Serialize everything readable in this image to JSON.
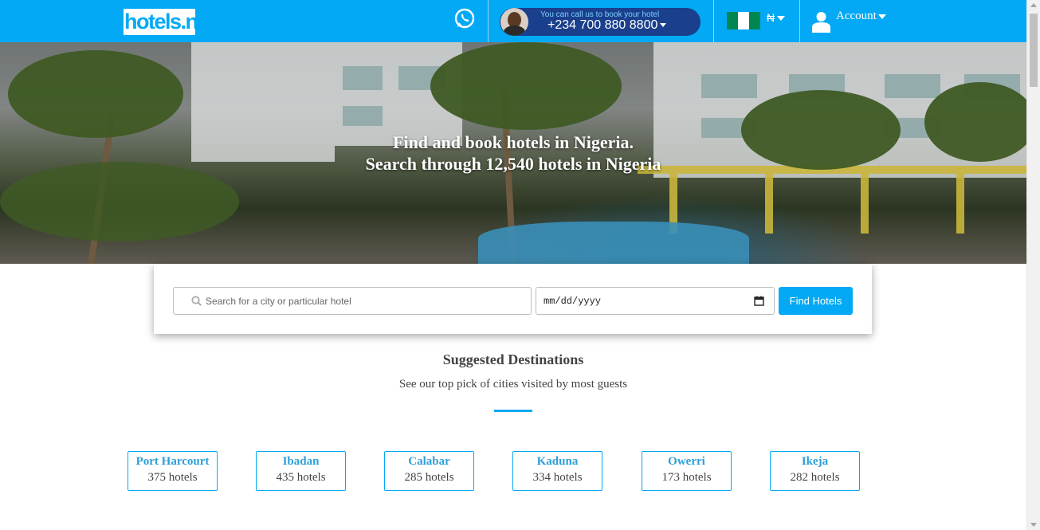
{
  "header": {
    "logo_text": "hotels.ng",
    "whatsapp_icon": "whatsapp-icon",
    "call_line1": "You can call us to book your hotel",
    "call_line2": "+234 700 880 8800",
    "currency": "₦",
    "account_label": "Account",
    "flag_colors": [
      "#008751",
      "#ffffff",
      "#008751"
    ]
  },
  "hero": {
    "line1": "Find and book hotels in Nigeria.",
    "line2": "Search through 12,540 hotels in Nigeria"
  },
  "search": {
    "placeholder": "Search for a city or particular hotel",
    "date_placeholder": "mm/dd/yyyy",
    "button_label": "Find Hotels"
  },
  "suggestions": {
    "title": "Suggested Destinations",
    "subtitle": "See our top pick of cities visited by most guests",
    "destinations": [
      {
        "name": "Port Harcourt",
        "count": "375 hotels"
      },
      {
        "name": "Ibadan",
        "count": "435 hotels"
      },
      {
        "name": "Calabar",
        "count": "285 hotels"
      },
      {
        "name": "Kaduna",
        "count": "334 hotels"
      },
      {
        "name": "Owerri",
        "count": "173 hotels"
      },
      {
        "name": "Ikeja",
        "count": "282 hotels"
      }
    ]
  },
  "colors": {
    "brand": "#03a9f4",
    "call_box": "#1a3f8c"
  }
}
